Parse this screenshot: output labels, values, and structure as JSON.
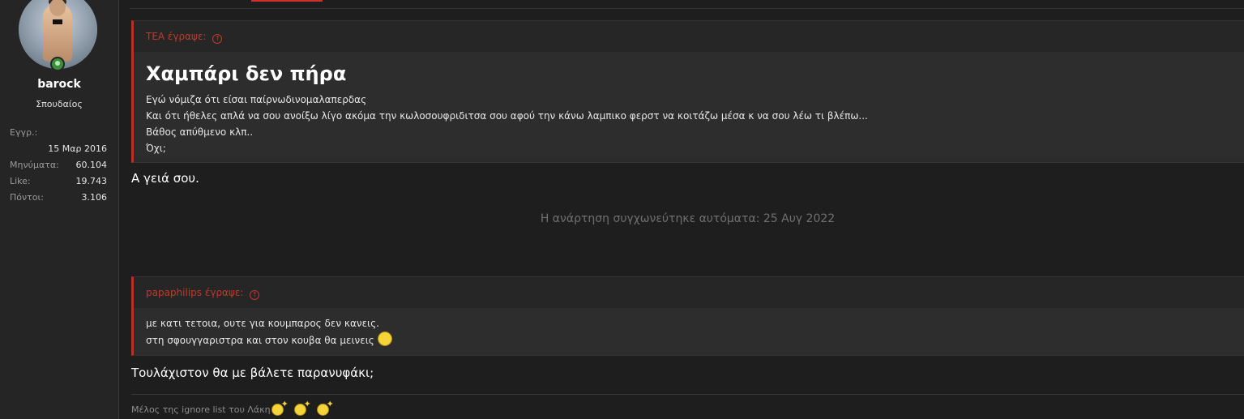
{
  "sidebar": {
    "username": "barock",
    "user_title": "Σπουδαίος",
    "stats": [
      {
        "label": "Εγγρ.:",
        "value": ""
      },
      {
        "label": "",
        "value": "15 Μαρ 2016"
      },
      {
        "label": "Μηνύματα:",
        "value": "60.104"
      },
      {
        "label": "Like:",
        "value": "19.743"
      },
      {
        "label": "Πόντοι:",
        "value": "3.106"
      }
    ]
  },
  "quotes": [
    {
      "author_line": "TEA έγραψε:",
      "title": "Χαμπάρι δεν πήρα",
      "lines": [
        "Εγώ νόμιζα ότι είσαι παίρνωδινομαλαπερδας",
        "Και ότι ήθελες απλά να σου ανοίξω λίγο ακόμα την κωλοσουφριδιτσα σου αφού την κάνω λαμπικο φερστ να κοιτάζω μέσα κ να σου λέω τι βλέπω...",
        "Βάθος απύθμενο κλπ..",
        "Όχι;"
      ]
    },
    {
      "author_line": "papaphilips έγραψε:",
      "lines": [
        "με κατι τετοια, ουτε για κουμπαρος δεν κανεις.",
        "στη σφουγγαριστρα και στον κουβα θα μεινεις"
      ]
    }
  ],
  "post": {
    "reply_1": "Α γειά σου.",
    "auto_merge": "Η ανάρτηση συγχωνεύτηκε αυτόματα: 25 Αυγ 2022",
    "reply_2": "Τουλάχιστον θα με βάλετε παρανυφάκι;"
  },
  "signature": {
    "text": "Μέλος της ignore list του Λάκη",
    "emoji": [
      "dancing-smiley-icon",
      "dancing-smiley-icon",
      "dancing-smiley-icon"
    ]
  },
  "colors": {
    "accent": "#c0392b",
    "background": "#1e1e1e",
    "sidebar": "#252525",
    "quote_bg": "#2d2d2d"
  }
}
